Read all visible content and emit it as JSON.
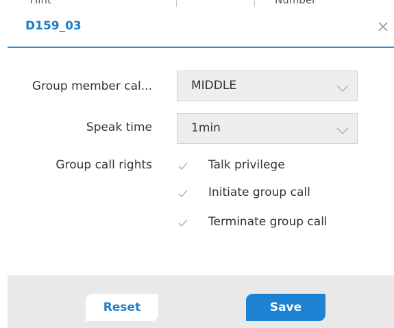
{
  "background_peek": {
    "left_text": "Hint",
    "right_text": "Number"
  },
  "dialog": {
    "title": "D159_03",
    "close_icon": "close-icon",
    "accent_color": "#1e7dc8"
  },
  "form": {
    "group_member_call": {
      "label": "Group member cal...",
      "value": "MIDDLE",
      "icon": "chevron-down-icon"
    },
    "speak_time": {
      "label": "Speak time",
      "value": "1min",
      "icon": "chevron-down-icon"
    },
    "group_call_rights": {
      "label": "Group call rights",
      "options": [
        {
          "label": "Talk privilege",
          "checked": true
        },
        {
          "label": "Initiate group call",
          "checked": true
        },
        {
          "label": "Terminate group call",
          "checked": true
        }
      ]
    }
  },
  "footer": {
    "reset_label": "Reset",
    "save_label": "Save"
  }
}
